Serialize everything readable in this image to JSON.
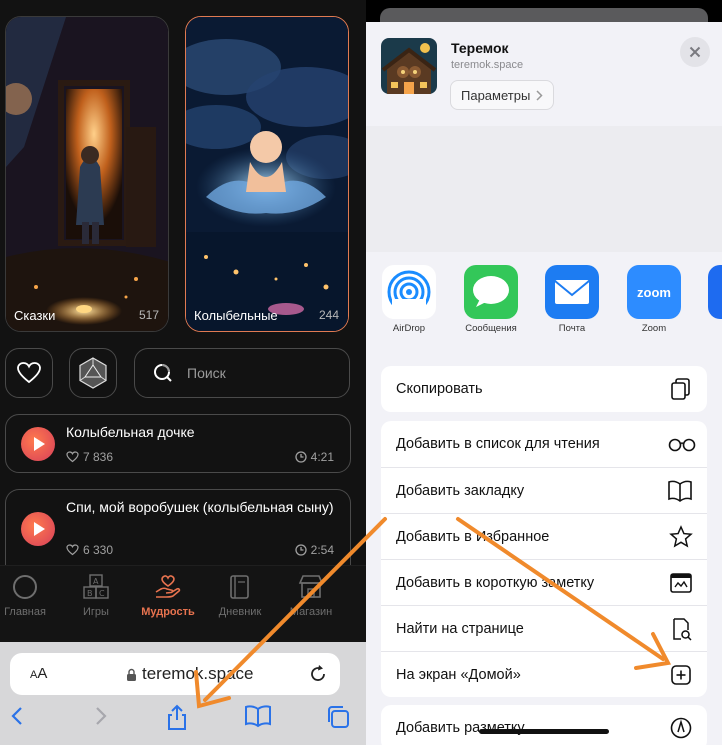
{
  "left": {
    "cards": [
      {
        "title": "Сказки",
        "count": "517"
      },
      {
        "title": "Колыбельные",
        "count": "244"
      }
    ],
    "search_placeholder": "Поиск",
    "tracks": [
      {
        "title": "Колыбельная дочке",
        "likes": "7 836",
        "duration": "4:21"
      },
      {
        "title": "Спи, мой воробушек (колыбельная сыну)",
        "likes": "6 330",
        "duration": "2:54"
      }
    ],
    "tabs": [
      {
        "label": "Главная",
        "icon": "circle-icon"
      },
      {
        "label": "Игры",
        "icon": "abc-blocks-icon"
      },
      {
        "label": "Мудрость",
        "icon": "hand-heart-icon",
        "active": true
      },
      {
        "label": "Дневник",
        "icon": "diary-icon"
      },
      {
        "label": "Магазин",
        "icon": "shop-icon"
      }
    ],
    "safari": {
      "aa_label_small": "A",
      "aa_label_big": "A",
      "url": "teremok.space"
    },
    "accent_color": "#e8734f"
  },
  "right": {
    "header": {
      "title": "Теремок",
      "domain": "teremok.space",
      "params_label": "Параметры"
    },
    "apps": [
      {
        "label": "AirDrop",
        "icon": "airdrop-icon"
      },
      {
        "label": "Сообщения",
        "icon": "messages-icon"
      },
      {
        "label": "Почта",
        "icon": "mail-icon"
      },
      {
        "label": "Zoom",
        "icon": "zoom-icon",
        "text": "zoom"
      }
    ],
    "copy_action": {
      "label": "Скопировать",
      "icon": "copy-icon"
    },
    "actions": [
      {
        "label": "Добавить в список для чтения",
        "icon": "glasses-icon"
      },
      {
        "label": "Добавить закладку",
        "icon": "book-icon"
      },
      {
        "label": "Добавить в Избранное",
        "icon": "star-icon"
      },
      {
        "label": "Добавить в короткую заметку",
        "icon": "quick-note-icon"
      },
      {
        "label": "Найти на странице",
        "icon": "find-in-page-icon"
      },
      {
        "label": "На экран «Домой»",
        "icon": "add-square-icon"
      }
    ],
    "last_action": {
      "label": "Добавить разметку",
      "icon": "markup-icon"
    },
    "arrow_color": "#f08a2c"
  }
}
